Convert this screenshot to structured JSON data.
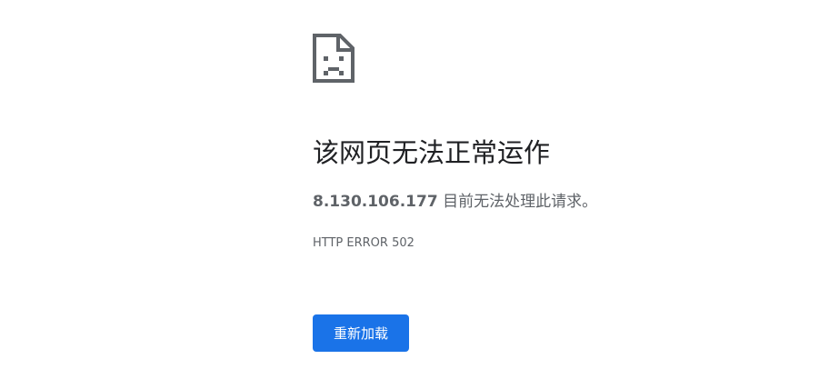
{
  "icon": "sad-page-icon",
  "heading": "该网页无法正常运作",
  "message": {
    "host": "8.130.106.177",
    "text": " 目前无法处理此请求。"
  },
  "error_code": "HTTP ERROR 502",
  "reload_button_label": "重新加载",
  "colors": {
    "accent": "#1a73e8",
    "heading": "#202124",
    "body_text": "#5f6368",
    "icon": "#5f6368"
  }
}
